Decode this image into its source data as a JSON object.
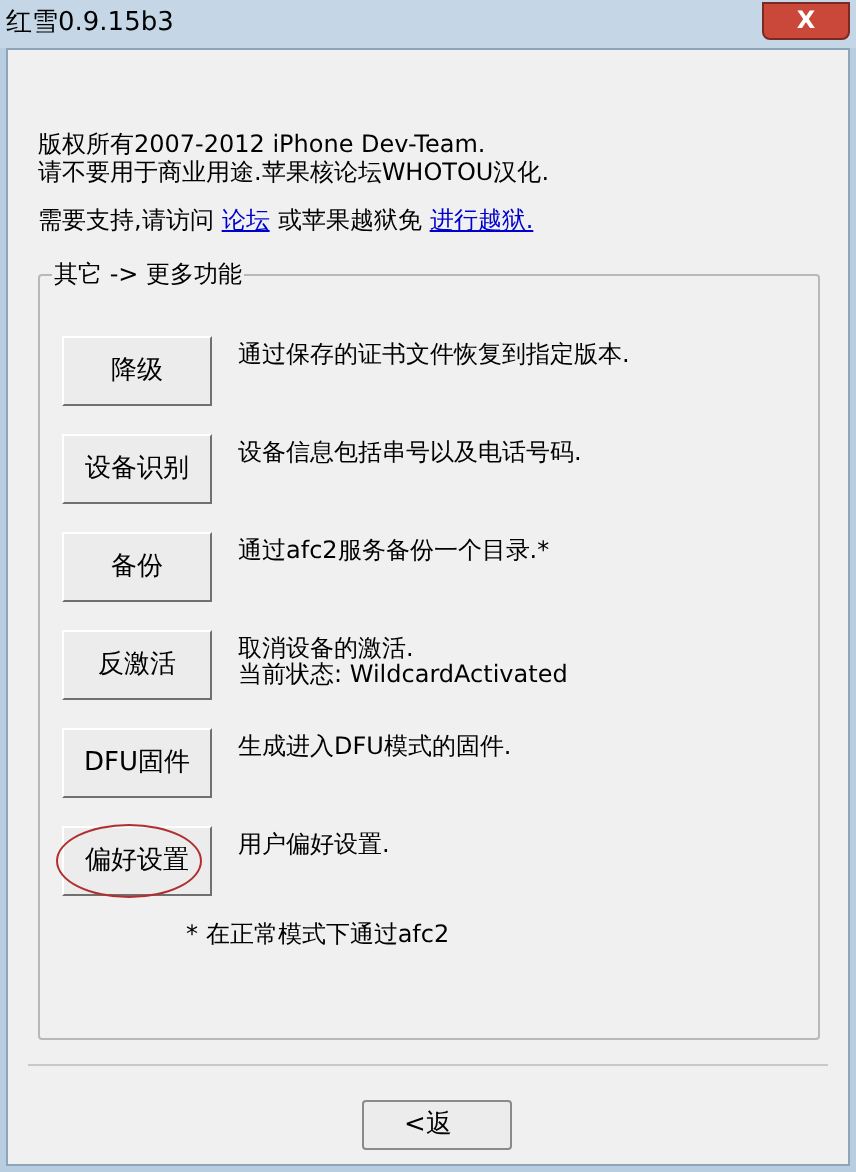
{
  "window": {
    "title": "红雪0.9.15b3",
    "close": "X"
  },
  "intro": {
    "lines": [
      "版权所有2007-2012 iPhone Dev-Team.",
      "请不要用于商业用途.苹果核论坛WHOTOU汉化."
    ],
    "support_prefix": "需要支持,请访问",
    "forum_link": "论坛",
    "support_middle": "或苹果越狱免",
    "jailbreak_link": "进行越狱."
  },
  "group": {
    "title": "其它 -> 更多功能",
    "actions": [
      {
        "button": "降级",
        "description": [
          "通过保存的证书文件恢复到指定版本."
        ],
        "highlighted": false
      },
      {
        "button": "设备识别",
        "description": [
          "设备信息包括串号以及电话号码."
        ],
        "highlighted": false
      },
      {
        "button": "备份",
        "description": [
          "通过afc2服务备份一个目录.*"
        ],
        "highlighted": false
      },
      {
        "button": "反激活",
        "description": [
          "取消设备的激活.",
          "当前状态: WildcardActivated"
        ],
        "highlighted": false
      },
      {
        "button": "DFU固件",
        "description": [
          "生成进入DFU模式的固件."
        ],
        "highlighted": false
      },
      {
        "button": "偏好设置",
        "description": [
          "用户偏好设置."
        ],
        "highlighted": true
      }
    ],
    "footnote": "* 在正常模式下通过afc2"
  },
  "back_button": "<返"
}
